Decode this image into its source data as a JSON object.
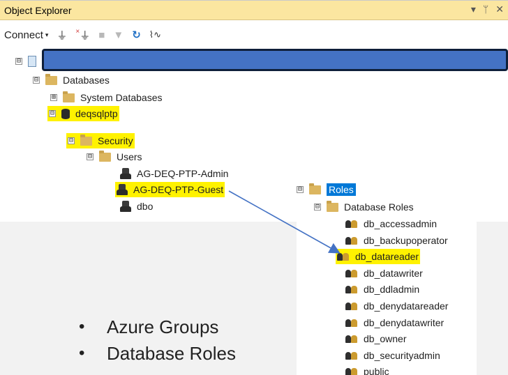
{
  "window": {
    "title": "Object Explorer",
    "controls": [
      "▾",
      "ᛘ",
      "✕"
    ]
  },
  "toolbar": {
    "connect_label": "Connect",
    "caret": "▾",
    "icons": [
      "connect-plug-icon",
      "disconnect-plug-icon",
      "stop-icon",
      "filter-icon",
      "refresh-icon",
      "activity-monitor-icon"
    ]
  },
  "tree": {
    "server_collapse": "⊟",
    "databases": {
      "label": "Databases",
      "expander": "⊟"
    },
    "system_databases": {
      "label": "System Databases",
      "expander": "⊞"
    },
    "db": {
      "label": "deqsqlptp",
      "expander": "⊟"
    },
    "security": {
      "label": "Security",
      "expander": "⊟"
    },
    "users": {
      "label": "Users",
      "expander": "⊟",
      "items": [
        "AG-DEQ-PTP-Admin",
        "AG-DEQ-PTP-Guest",
        "dbo"
      ]
    }
  },
  "roles": {
    "label": "Roles",
    "expander": "⊟",
    "database_roles": {
      "label": "Database Roles",
      "expander": "⊟",
      "items": [
        "db_accessadmin",
        "db_backupoperator",
        "db_datareader",
        "db_datawriter",
        "db_ddladmin",
        "db_denydatareader",
        "db_denydatawriter",
        "db_owner",
        "db_securityadmin",
        "public"
      ]
    }
  },
  "bullets": [
    "Azure Groups",
    "Database Roles"
  ],
  "colors": {
    "titlebar": "#fbe6a0",
    "highlight": "#fff200",
    "selection": "#0078d7",
    "arrow": "#4472c4",
    "redacted_bar": "#4472c4"
  }
}
